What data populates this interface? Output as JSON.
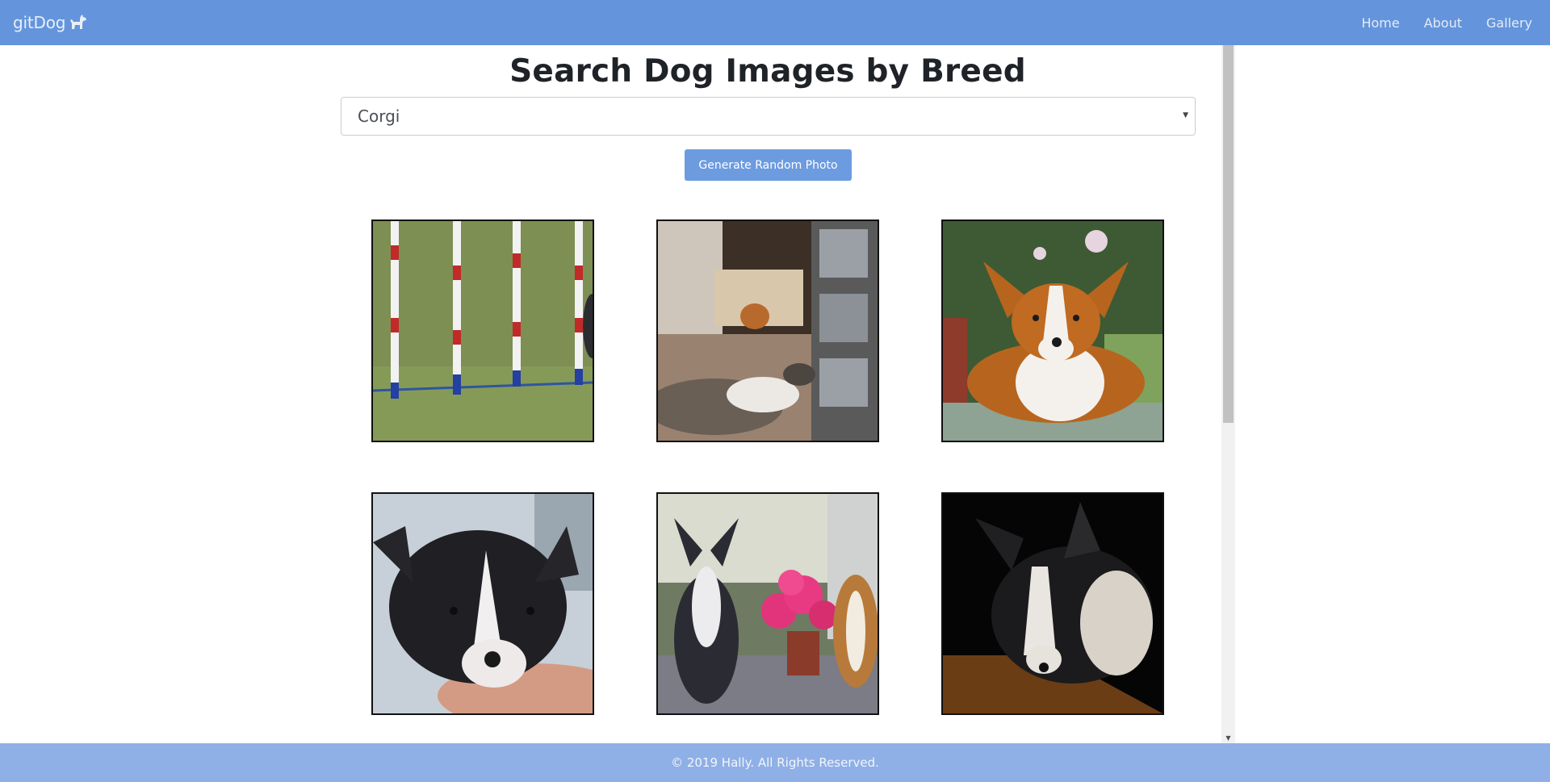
{
  "navbar": {
    "brand": "gitDog",
    "brand_icon": "dog-icon",
    "links": [
      "Home",
      "About",
      "Gallery"
    ]
  },
  "main": {
    "title": "Search Dog Images by Breed",
    "breed_select": {
      "selected": "Corgi"
    },
    "random_button_label": "Generate Random Photo",
    "gallery": [
      {
        "subject": "weave-poles-on-grass"
      },
      {
        "subject": "corgi-in-living-room"
      },
      {
        "subject": "red-white-corgi-lying"
      },
      {
        "subject": "black-white-corgi-puppy"
      },
      {
        "subject": "two-corgis-with-flowers"
      },
      {
        "subject": "corgi-in-shadow"
      }
    ]
  },
  "footer": {
    "text": "© 2019 Hally. All Rights Reserved."
  },
  "colors": {
    "navbar": "#6495dc",
    "button": "#6c9be0",
    "footer": "#8fb0e6"
  }
}
